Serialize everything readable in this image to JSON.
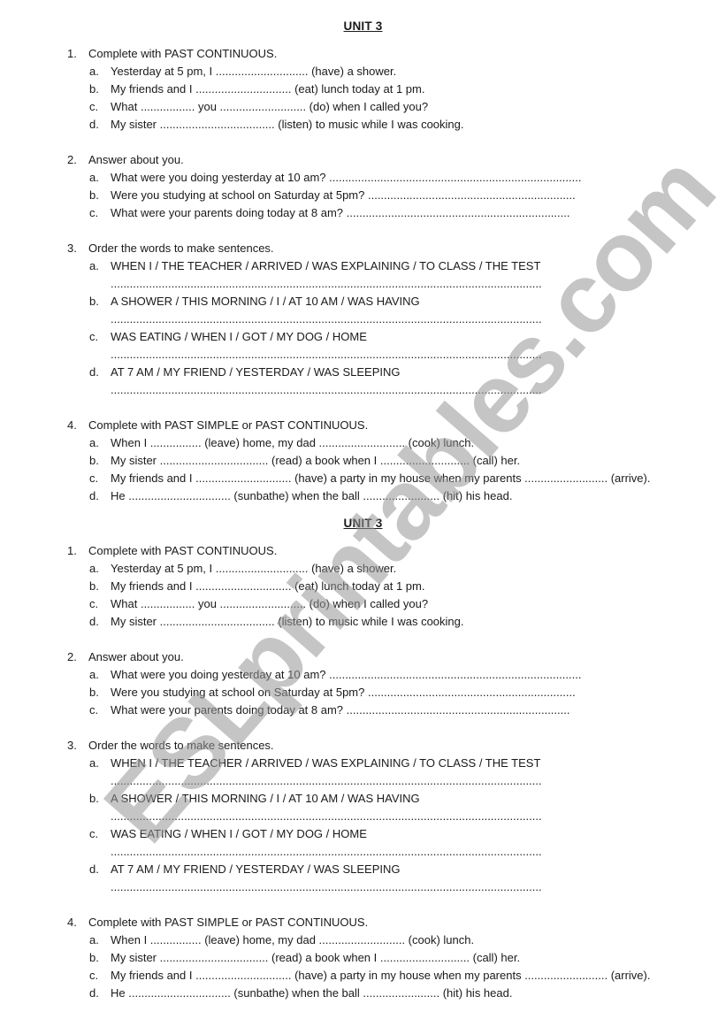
{
  "worksheet": {
    "copies": [
      {
        "title": "UNIT 3",
        "exercises": [
          {
            "number": "1.",
            "instruction": "Complete with PAST CONTINUOUS.",
            "items": [
              {
                "letter": "a.",
                "text": "Yesterday at 5 pm, I ............................. (have) a shower."
              },
              {
                "letter": "b.",
                "text": "My friends and I .............................. (eat) lunch today at 1 pm."
              },
              {
                "letter": "c.",
                "text": "What ................. you ........................... (do) when I called you?"
              },
              {
                "letter": "d.",
                "text": "My sister .................................... (listen) to music while I was cooking."
              }
            ]
          },
          {
            "number": "2.",
            "instruction": "Answer about you.",
            "items": [
              {
                "letter": "a.",
                "text": "What were you doing yesterday at 10 am? ..............................................................................."
              },
              {
                "letter": "b.",
                "text": "Were you studying at school on Saturday at 5pm? ................................................................."
              },
              {
                "letter": "c.",
                "text": "What were your parents doing today at 8 am? ......................................................................"
              }
            ]
          },
          {
            "number": "3.",
            "instruction": "Order the words to make sentences.",
            "items": [
              {
                "letter": "a.",
                "text": "WHEN I / THE TEACHER / ARRIVED / WAS EXPLAINING / TO CLASS / THE TEST",
                "answer_line": "......................................................................................................................................."
              },
              {
                "letter": "b.",
                "text": "A SHOWER / THIS MORNING / I / AT 10 AM / WAS HAVING",
                "answer_line": "......................................................................................................................................."
              },
              {
                "letter": "c.",
                "text": "WAS EATING / WHEN I / GOT / MY DOG / HOME",
                "answer_line": "......................................................................................................................................."
              },
              {
                "letter": "d.",
                "text": "AT 7 AM / MY FRIEND / YESTERDAY / WAS SLEEPING",
                "answer_line": "......................................................................................................................................."
              }
            ]
          },
          {
            "number": "4.",
            "instruction": "Complete with PAST SIMPLE or PAST CONTINUOUS.",
            "items": [
              {
                "letter": "a.",
                "text": "When I ................ (leave) home, my dad ........................... (cook) lunch."
              },
              {
                "letter": "b.",
                "text": "My sister .................................. (read) a book when I ............................ (call) her."
              },
              {
                "letter": "c.",
                "text": "My friends and I .............................. (have) a party in my house when my parents .......................... (arrive)."
              },
              {
                "letter": "d.",
                "text": "He  ................................ (sunbathe) when the ball ........................ (hit) his head."
              }
            ]
          }
        ]
      },
      {
        "title": "UNIT 3",
        "exercises": [
          {
            "number": "1.",
            "instruction": "Complete with PAST CONTINUOUS.",
            "items": [
              {
                "letter": "a.",
                "text": "Yesterday at 5 pm, I ............................. (have) a shower."
              },
              {
                "letter": "b.",
                "text": "My friends and I .............................. (eat) lunch today at 1 pm."
              },
              {
                "letter": "c.",
                "text": "What ................. you ........................... (do) when I called you?"
              },
              {
                "letter": "d.",
                "text": "My sister .................................... (listen) to music while I was cooking."
              }
            ]
          },
          {
            "number": "2.",
            "instruction": "Answer about you.",
            "items": [
              {
                "letter": "a.",
                "text": "What were you doing yesterday at 10 am? ..............................................................................."
              },
              {
                "letter": "b.",
                "text": "Were you studying at school on Saturday at 5pm? ................................................................."
              },
              {
                "letter": "c.",
                "text": "What were your parents doing today at 8 am? ......................................................................"
              }
            ]
          },
          {
            "number": "3.",
            "instruction": "Order the words to make sentences.",
            "items": [
              {
                "letter": "a.",
                "text": "WHEN I / THE TEACHER / ARRIVED / WAS EXPLAINING / TO CLASS / THE TEST",
                "answer_line": "......................................................................................................................................."
              },
              {
                "letter": "b.",
                "text": "A SHOWER / THIS MORNING / I / AT 10 AM / WAS HAVING",
                "answer_line": "......................................................................................................................................."
              },
              {
                "letter": "c.",
                "text": "WAS EATING / WHEN I / GOT / MY DOG / HOME",
                "answer_line": "......................................................................................................................................."
              },
              {
                "letter": "d.",
                "text": "AT 7 AM / MY FRIEND / YESTERDAY / WAS SLEEPING",
                "answer_line": "......................................................................................................................................."
              }
            ]
          },
          {
            "number": "4.",
            "instruction": "Complete with PAST SIMPLE or PAST CONTINUOUS.",
            "items": [
              {
                "letter": "a.",
                "text": "When I ................ (leave) home, my dad ........................... (cook) lunch."
              },
              {
                "letter": "b.",
                "text": "My sister .................................. (read) a book when I ............................ (call) her."
              },
              {
                "letter": "c.",
                "text": "My friends and I .............................. (have) a party in my house when my parents .......................... (arrive)."
              },
              {
                "letter": "d.",
                "text": "He  ................................ (sunbathe) when the ball ........................ (hit) his head."
              }
            ]
          }
        ]
      }
    ]
  },
  "watermark": {
    "text": "ESLprintables.com",
    "color": "#9a9a9a"
  }
}
